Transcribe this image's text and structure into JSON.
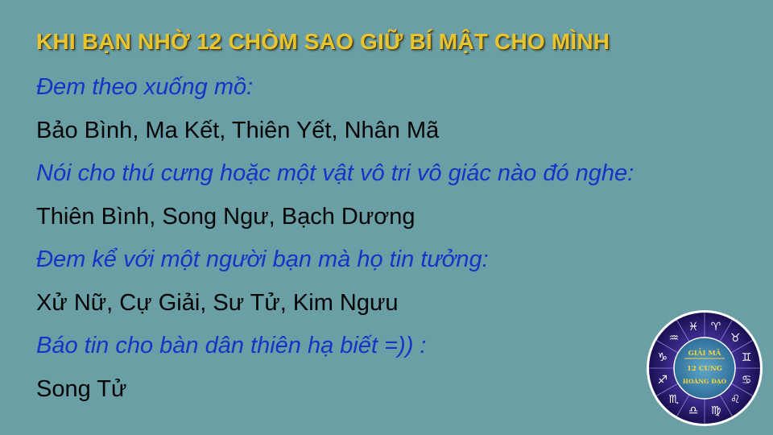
{
  "title": "KHI BẠN NHỜ 12 CHÒM SAO GIỮ BÍ MẬT CHO MÌNH",
  "sections": [
    {
      "heading": "Đem theo xuống mồ:",
      "answer": "Bảo Bình, Ma Kết, Thiên Yết, Nhân Mã"
    },
    {
      "heading": "Nói cho thú cưng hoặc một vật vô tri vô giác nào đó nghe:",
      "answer": "Thiên Bình, Song Ngư, Bạch Dương"
    },
    {
      "heading": "Đem kể với một người bạn mà họ tin tưởng:",
      "answer": "Xử Nữ, Cự Giải, Sư Tử, Kim Ngưu"
    },
    {
      "heading": "Báo tin cho bàn dân thiên hạ biết =)) :",
      "answer": "Song Tử"
    }
  ],
  "badge": {
    "line1": "GIẢI MÃ",
    "line2": "12 CUNG",
    "line3": "HOÀNG ĐẠO"
  },
  "colors": {
    "background": "#6b9fa6",
    "title": "#e8c42e",
    "heading": "#1832c8",
    "answer": "#050505",
    "badge_ring": "#2a1a6e"
  }
}
